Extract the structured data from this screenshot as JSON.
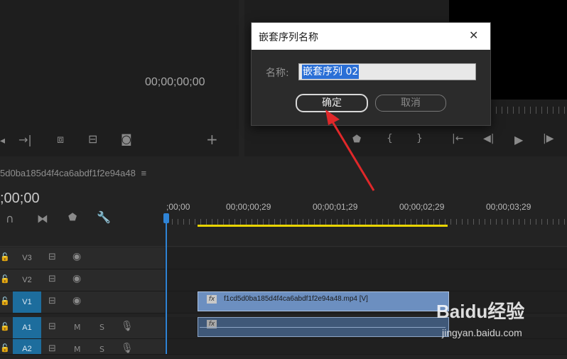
{
  "source_monitor": {
    "timecode": "00;00;00;00"
  },
  "program_monitor": {},
  "timeline": {
    "sequence_name": "5d0ba185d4f4ca6abdf1f2e94a48",
    "menu_glyph": "≡",
    "current_timecode": ";00;00",
    "ruler": ";00;00",
    "ruler_ticks": [
      "00;00;00;29",
      "00;00;01;29",
      "00;00;02;29",
      "00;00;03;29"
    ],
    "tracks": [
      {
        "label": "V3",
        "active": false,
        "kind": "video"
      },
      {
        "label": "V2",
        "active": false,
        "kind": "video"
      },
      {
        "label": "V1",
        "active": true,
        "kind": "video"
      },
      {
        "label": "A1",
        "active": true,
        "kind": "audio",
        "mute": "M",
        "solo": "S"
      },
      {
        "label": "A2",
        "active": true,
        "kind": "audio",
        "mute": "M",
        "solo": "S"
      }
    ],
    "video_clip": {
      "fx": "fx",
      "name": "f1cd5d0ba185d4f4ca6abdf1f2e94a48.mp4 [V]"
    },
    "audio_clip": {
      "fx": "fx"
    }
  },
  "dialog": {
    "title": "嵌套序列名称",
    "close_glyph": "✕",
    "name_label": "名称:",
    "name_value": "嵌套序列 02",
    "ok_label": "确定",
    "cancel_label": "取消"
  },
  "watermark": {
    "text": "Baidu经验",
    "url": "jingyan.baidu.com"
  },
  "colors": {
    "accent": "#1d6d9d",
    "clip_video": "#6c8fc0",
    "clip_audio": "#3f5878",
    "arrow": "#e0282a",
    "work_area": "#e8d400",
    "playhead": "#2f84d6"
  }
}
